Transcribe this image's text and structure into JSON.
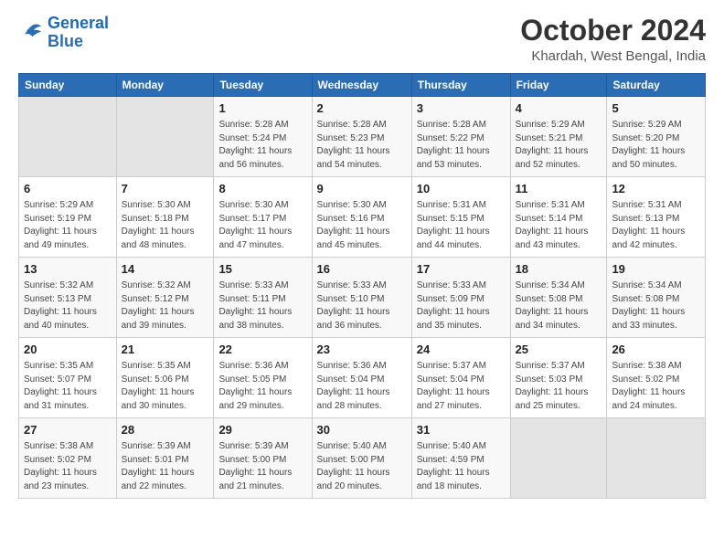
{
  "logo": {
    "line1": "General",
    "line2": "Blue"
  },
  "header": {
    "month": "October 2024",
    "location": "Khardah, West Bengal, India"
  },
  "weekdays": [
    "Sunday",
    "Monday",
    "Tuesday",
    "Wednesday",
    "Thursday",
    "Friday",
    "Saturday"
  ],
  "weeks": [
    [
      {
        "day": "",
        "sunrise": "",
        "sunset": "",
        "daylight": ""
      },
      {
        "day": "",
        "sunrise": "",
        "sunset": "",
        "daylight": ""
      },
      {
        "day": "1",
        "sunrise": "Sunrise: 5:28 AM",
        "sunset": "Sunset: 5:24 PM",
        "daylight": "Daylight: 11 hours and 56 minutes."
      },
      {
        "day": "2",
        "sunrise": "Sunrise: 5:28 AM",
        "sunset": "Sunset: 5:23 PM",
        "daylight": "Daylight: 11 hours and 54 minutes."
      },
      {
        "day": "3",
        "sunrise": "Sunrise: 5:28 AM",
        "sunset": "Sunset: 5:22 PM",
        "daylight": "Daylight: 11 hours and 53 minutes."
      },
      {
        "day": "4",
        "sunrise": "Sunrise: 5:29 AM",
        "sunset": "Sunset: 5:21 PM",
        "daylight": "Daylight: 11 hours and 52 minutes."
      },
      {
        "day": "5",
        "sunrise": "Sunrise: 5:29 AM",
        "sunset": "Sunset: 5:20 PM",
        "daylight": "Daylight: 11 hours and 50 minutes."
      }
    ],
    [
      {
        "day": "6",
        "sunrise": "Sunrise: 5:29 AM",
        "sunset": "Sunset: 5:19 PM",
        "daylight": "Daylight: 11 hours and 49 minutes."
      },
      {
        "day": "7",
        "sunrise": "Sunrise: 5:30 AM",
        "sunset": "Sunset: 5:18 PM",
        "daylight": "Daylight: 11 hours and 48 minutes."
      },
      {
        "day": "8",
        "sunrise": "Sunrise: 5:30 AM",
        "sunset": "Sunset: 5:17 PM",
        "daylight": "Daylight: 11 hours and 47 minutes."
      },
      {
        "day": "9",
        "sunrise": "Sunrise: 5:30 AM",
        "sunset": "Sunset: 5:16 PM",
        "daylight": "Daylight: 11 hours and 45 minutes."
      },
      {
        "day": "10",
        "sunrise": "Sunrise: 5:31 AM",
        "sunset": "Sunset: 5:15 PM",
        "daylight": "Daylight: 11 hours and 44 minutes."
      },
      {
        "day": "11",
        "sunrise": "Sunrise: 5:31 AM",
        "sunset": "Sunset: 5:14 PM",
        "daylight": "Daylight: 11 hours and 43 minutes."
      },
      {
        "day": "12",
        "sunrise": "Sunrise: 5:31 AM",
        "sunset": "Sunset: 5:13 PM",
        "daylight": "Daylight: 11 hours and 42 minutes."
      }
    ],
    [
      {
        "day": "13",
        "sunrise": "Sunrise: 5:32 AM",
        "sunset": "Sunset: 5:13 PM",
        "daylight": "Daylight: 11 hours and 40 minutes."
      },
      {
        "day": "14",
        "sunrise": "Sunrise: 5:32 AM",
        "sunset": "Sunset: 5:12 PM",
        "daylight": "Daylight: 11 hours and 39 minutes."
      },
      {
        "day": "15",
        "sunrise": "Sunrise: 5:33 AM",
        "sunset": "Sunset: 5:11 PM",
        "daylight": "Daylight: 11 hours and 38 minutes."
      },
      {
        "day": "16",
        "sunrise": "Sunrise: 5:33 AM",
        "sunset": "Sunset: 5:10 PM",
        "daylight": "Daylight: 11 hours and 36 minutes."
      },
      {
        "day": "17",
        "sunrise": "Sunrise: 5:33 AM",
        "sunset": "Sunset: 5:09 PM",
        "daylight": "Daylight: 11 hours and 35 minutes."
      },
      {
        "day": "18",
        "sunrise": "Sunrise: 5:34 AM",
        "sunset": "Sunset: 5:08 PM",
        "daylight": "Daylight: 11 hours and 34 minutes."
      },
      {
        "day": "19",
        "sunrise": "Sunrise: 5:34 AM",
        "sunset": "Sunset: 5:08 PM",
        "daylight": "Daylight: 11 hours and 33 minutes."
      }
    ],
    [
      {
        "day": "20",
        "sunrise": "Sunrise: 5:35 AM",
        "sunset": "Sunset: 5:07 PM",
        "daylight": "Daylight: 11 hours and 31 minutes."
      },
      {
        "day": "21",
        "sunrise": "Sunrise: 5:35 AM",
        "sunset": "Sunset: 5:06 PM",
        "daylight": "Daylight: 11 hours and 30 minutes."
      },
      {
        "day": "22",
        "sunrise": "Sunrise: 5:36 AM",
        "sunset": "Sunset: 5:05 PM",
        "daylight": "Daylight: 11 hours and 29 minutes."
      },
      {
        "day": "23",
        "sunrise": "Sunrise: 5:36 AM",
        "sunset": "Sunset: 5:04 PM",
        "daylight": "Daylight: 11 hours and 28 minutes."
      },
      {
        "day": "24",
        "sunrise": "Sunrise: 5:37 AM",
        "sunset": "Sunset: 5:04 PM",
        "daylight": "Daylight: 11 hours and 27 minutes."
      },
      {
        "day": "25",
        "sunrise": "Sunrise: 5:37 AM",
        "sunset": "Sunset: 5:03 PM",
        "daylight": "Daylight: 11 hours and 25 minutes."
      },
      {
        "day": "26",
        "sunrise": "Sunrise: 5:38 AM",
        "sunset": "Sunset: 5:02 PM",
        "daylight": "Daylight: 11 hours and 24 minutes."
      }
    ],
    [
      {
        "day": "27",
        "sunrise": "Sunrise: 5:38 AM",
        "sunset": "Sunset: 5:02 PM",
        "daylight": "Daylight: 11 hours and 23 minutes."
      },
      {
        "day": "28",
        "sunrise": "Sunrise: 5:39 AM",
        "sunset": "Sunset: 5:01 PM",
        "daylight": "Daylight: 11 hours and 22 minutes."
      },
      {
        "day": "29",
        "sunrise": "Sunrise: 5:39 AM",
        "sunset": "Sunset: 5:00 PM",
        "daylight": "Daylight: 11 hours and 21 minutes."
      },
      {
        "day": "30",
        "sunrise": "Sunrise: 5:40 AM",
        "sunset": "Sunset: 5:00 PM",
        "daylight": "Daylight: 11 hours and 20 minutes."
      },
      {
        "day": "31",
        "sunrise": "Sunrise: 5:40 AM",
        "sunset": "Sunset: 4:59 PM",
        "daylight": "Daylight: 11 hours and 18 minutes."
      },
      {
        "day": "",
        "sunrise": "",
        "sunset": "",
        "daylight": ""
      },
      {
        "day": "",
        "sunrise": "",
        "sunset": "",
        "daylight": ""
      }
    ]
  ]
}
